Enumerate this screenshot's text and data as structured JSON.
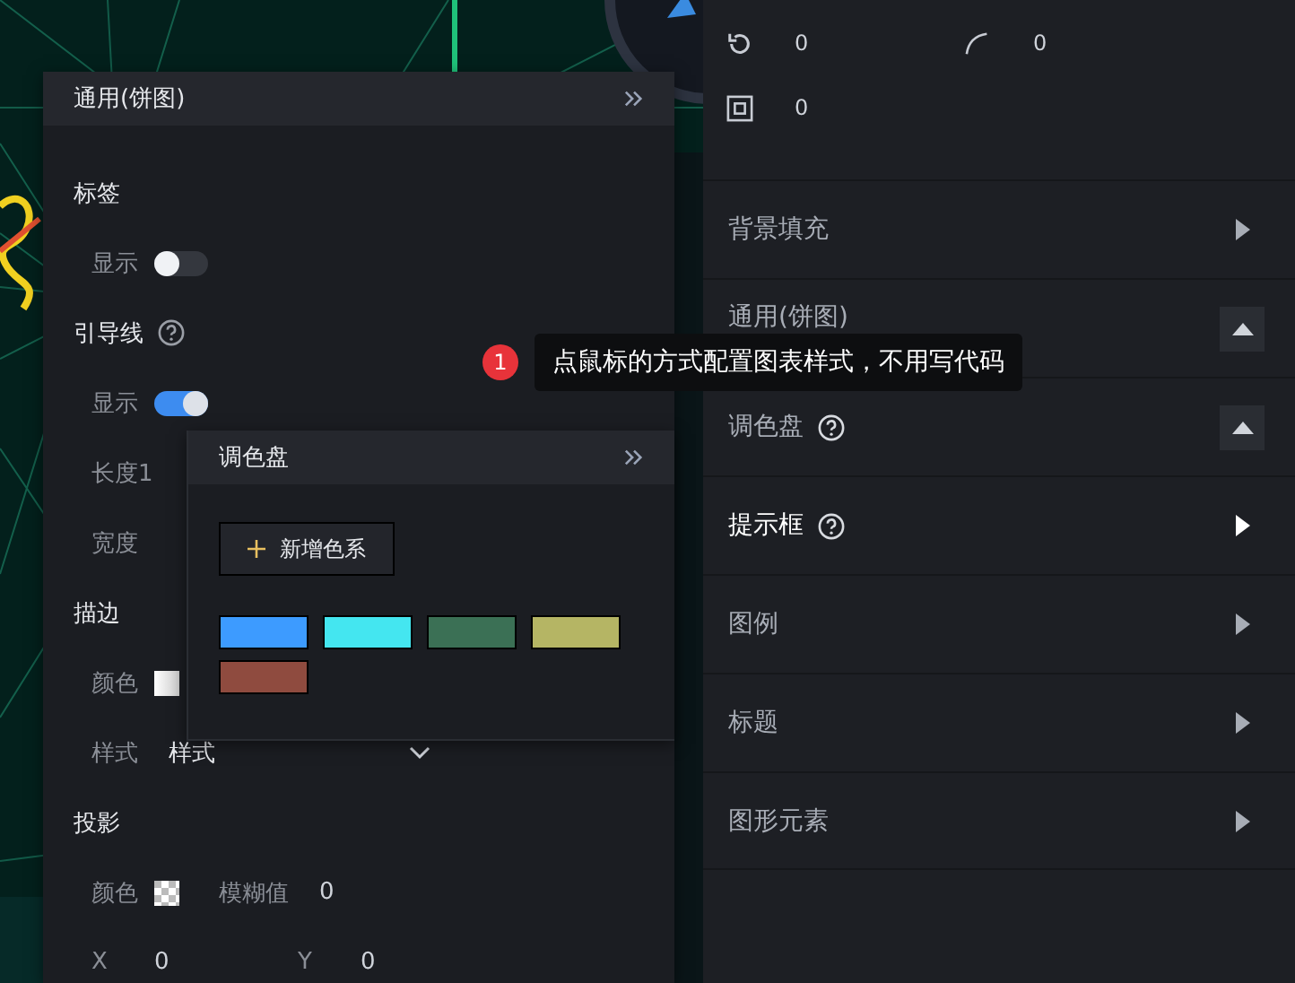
{
  "general_panel": {
    "title": "通用(饼图)",
    "label": {
      "title": "标签",
      "show_label": "显示",
      "on": false
    },
    "leader": {
      "title": "引导线",
      "show_label": "显示",
      "on": true,
      "length_label": "长度1",
      "width_label": "宽度"
    },
    "stroke": {
      "title": "描边",
      "color_label": "颜色",
      "style_label": "样式",
      "style_value": "样式"
    },
    "shadow": {
      "title": "投影",
      "color_label": "颜色",
      "blur_label": "模糊值",
      "blur_value": "0",
      "x_label": "X",
      "x_value": "0",
      "y_label": "Y",
      "y_value": "0"
    }
  },
  "palette_panel": {
    "title": "调色盘",
    "add_button": "新增色系",
    "swatches": [
      {
        "color": "#3d9bff"
      },
      {
        "color": "#44e6f0"
      },
      {
        "color": "#3b7055"
      },
      {
        "color": "#b5b564"
      },
      {
        "color": "#8f4b3f"
      }
    ]
  },
  "right_panel": {
    "metrics": [
      {
        "kind": "rotate",
        "value": "0"
      },
      {
        "kind": "radius",
        "value": "0"
      },
      {
        "kind": "border",
        "value": "0"
      }
    ],
    "sections": [
      {
        "title": "背景填充",
        "help": false,
        "expanded": false,
        "selected": false
      },
      {
        "title": "通用(饼图)",
        "help": false,
        "expanded": true,
        "selected": false
      },
      {
        "title": "调色盘",
        "help": true,
        "expanded": true,
        "selected": false
      },
      {
        "title": "提示框",
        "help": true,
        "expanded": false,
        "selected": true
      },
      {
        "title": "图例",
        "help": false,
        "expanded": false,
        "selected": false
      },
      {
        "title": "标题",
        "help": false,
        "expanded": false,
        "selected": false
      },
      {
        "title": "图形元素",
        "help": false,
        "expanded": false,
        "selected": false
      }
    ]
  },
  "tooltip": {
    "badge": "1",
    "text": "点鼠标的方式配置图表样式，不用写代码"
  }
}
